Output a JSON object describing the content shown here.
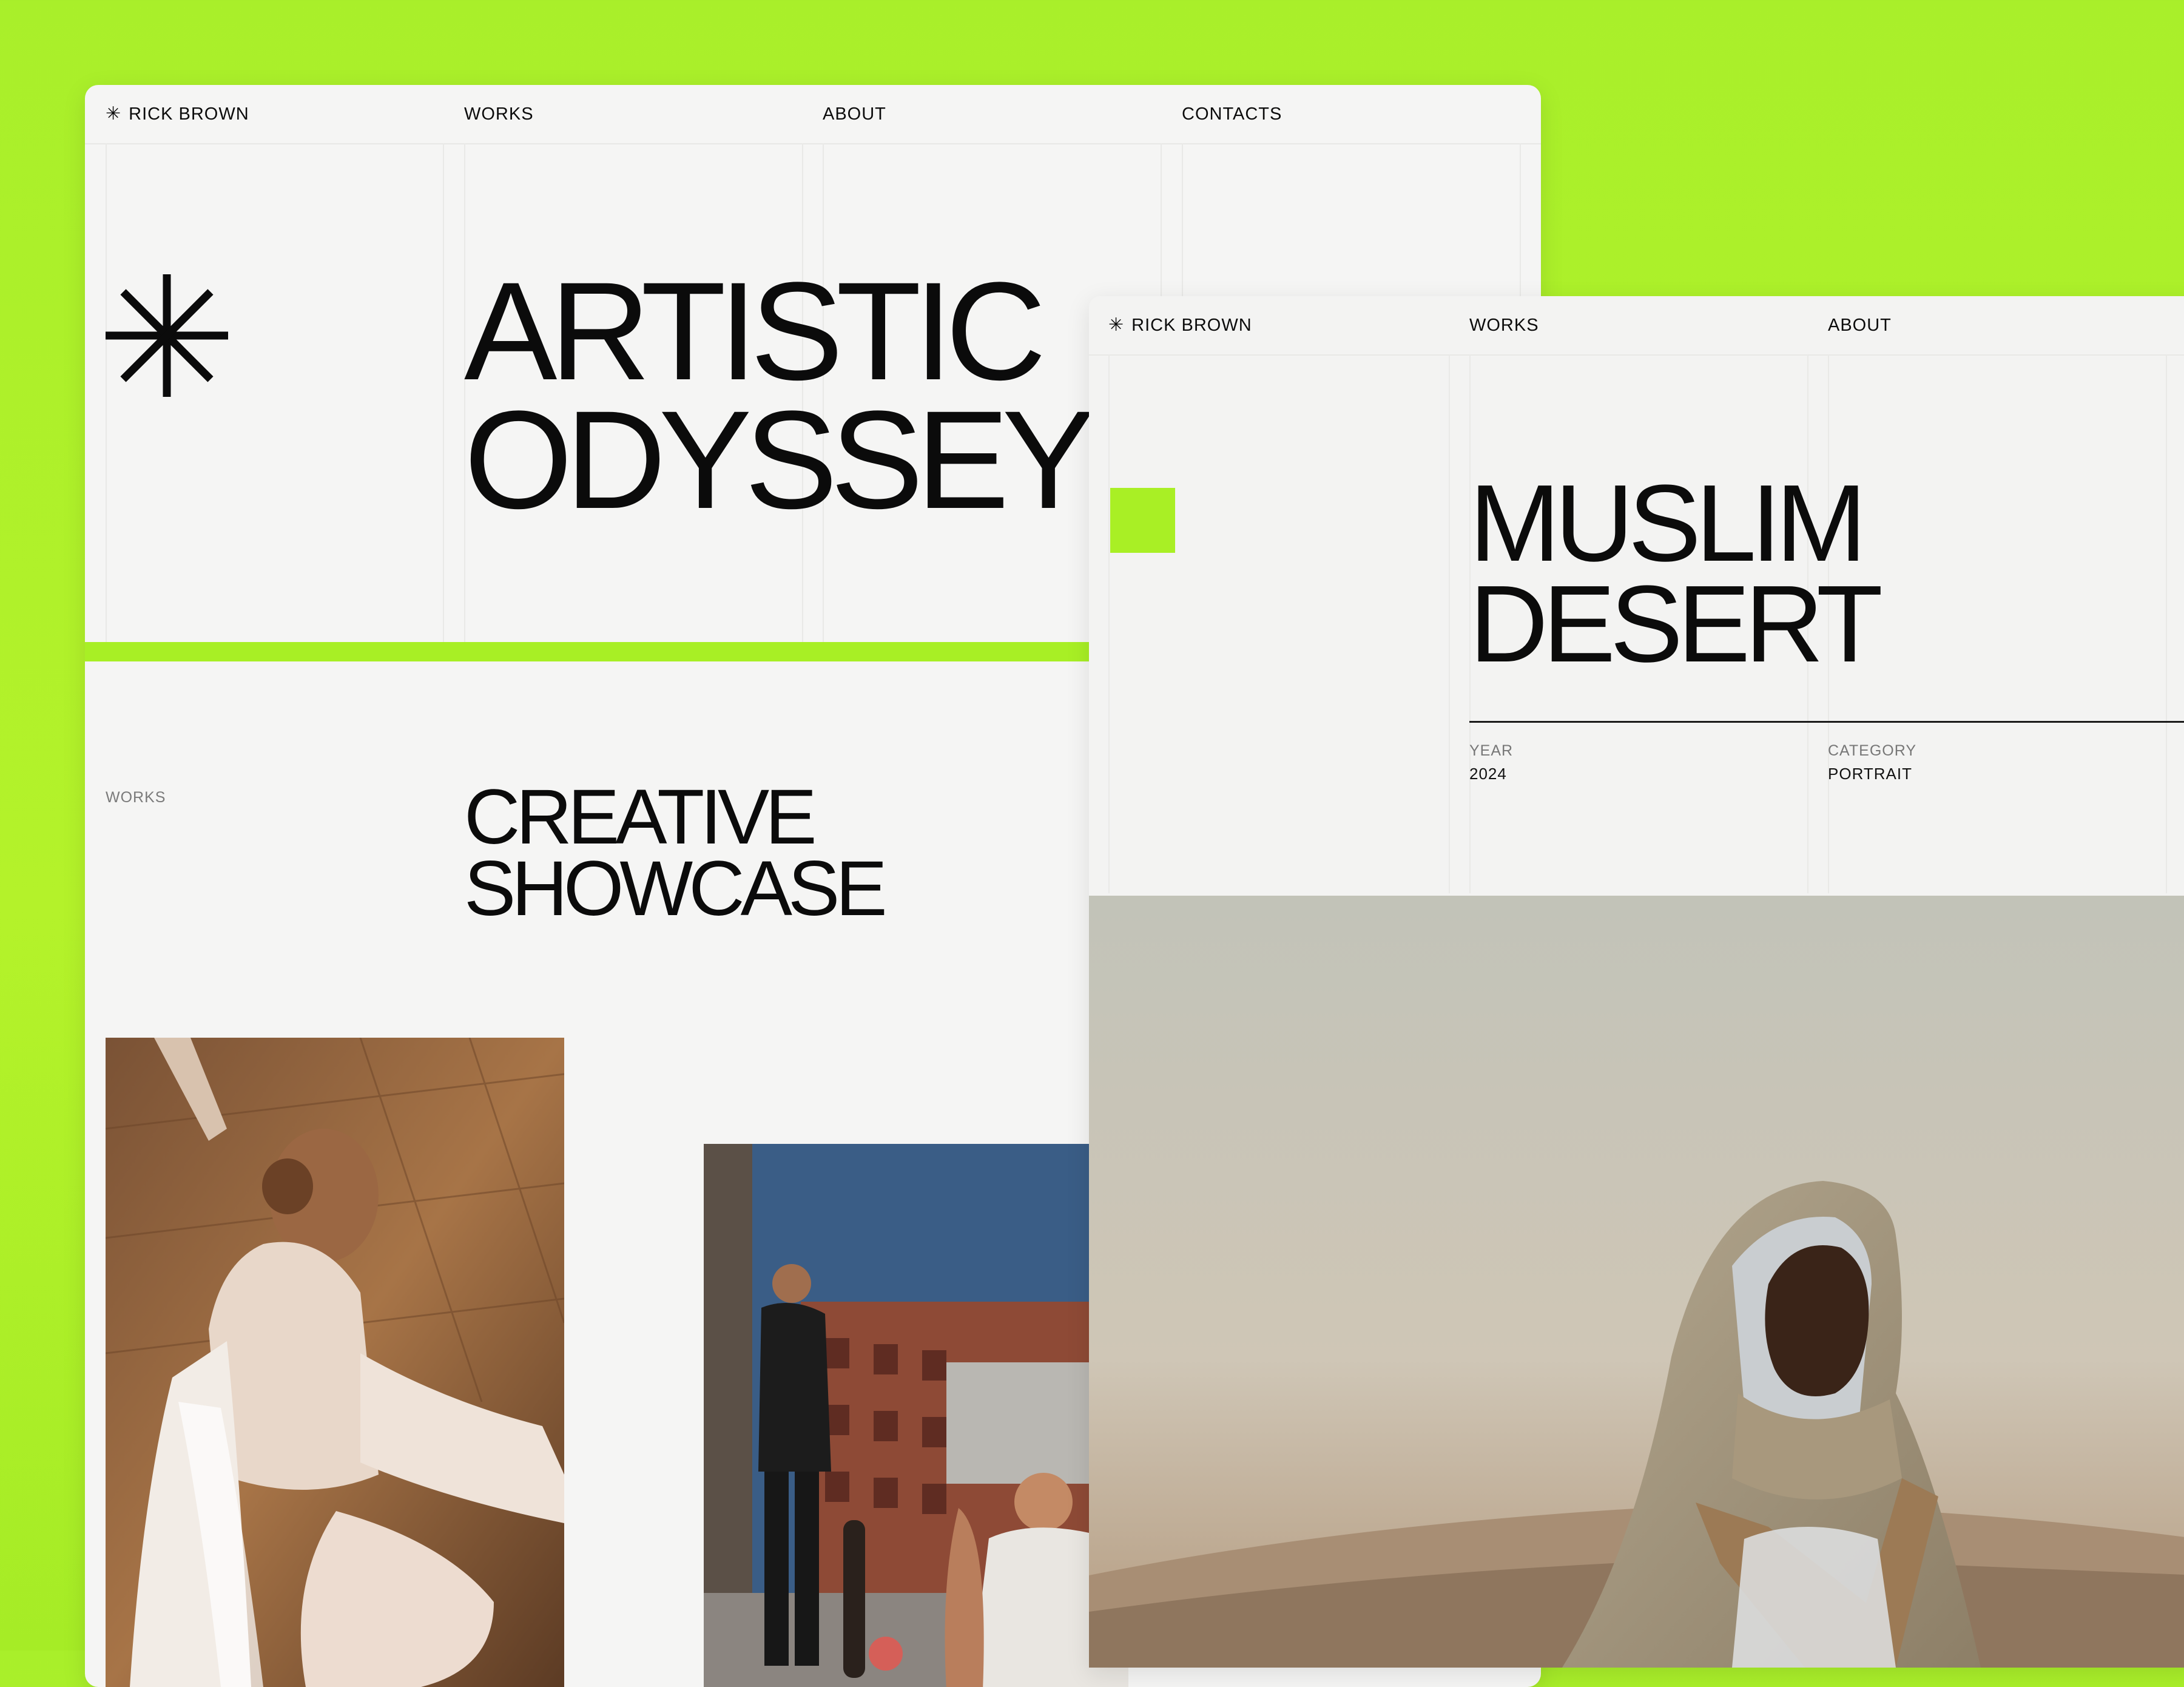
{
  "window_main": {
    "nav": {
      "brand_icon": "✳",
      "brand": "RICK BROWN",
      "works": "WORKS",
      "about": "ABOUT",
      "contacts": "CONTACTS"
    },
    "hero": {
      "line1": "ARTISTIC",
      "line2": "ODYSSEY",
      "icon": "asterisk-icon"
    },
    "works_label": "WORKS",
    "showcase": {
      "line1": "CREATIVE",
      "line2": "SHOWCASE"
    },
    "photos": [
      "ballet-dancer-photo",
      "street-skaters-photo"
    ]
  },
  "window_detail": {
    "nav": {
      "brand_icon": "✳",
      "brand": "RICK BROWN",
      "works": "WORKS",
      "about": "ABOUT"
    },
    "title": {
      "line1": "MUSLIM",
      "line2": "DESERT"
    },
    "meta": {
      "year_label": "YEAR",
      "year_value": "2024",
      "category_label": "CATEGORY",
      "category_value": "PORTRAIT"
    },
    "photo": "desert-portrait-photo"
  },
  "colors": {
    "accent": "#A9EF25",
    "page_bg": "#F5F5F4",
    "text": "#0B0B0B"
  }
}
